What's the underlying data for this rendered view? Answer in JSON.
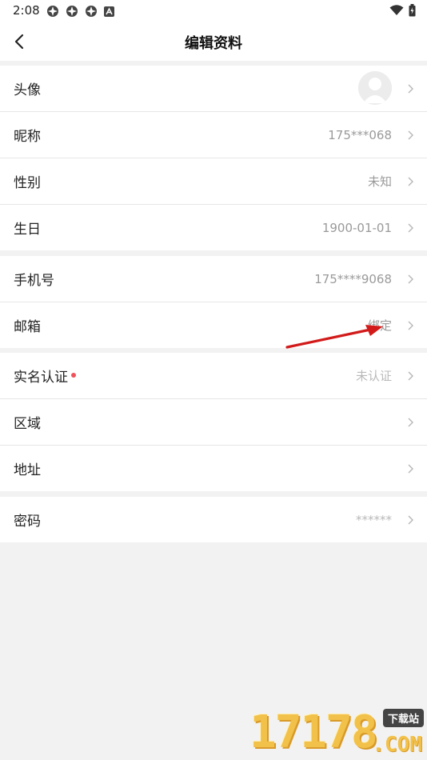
{
  "status_bar": {
    "time": "2:08"
  },
  "header": {
    "title": "编辑资料"
  },
  "groups": [
    {
      "rows": [
        {
          "label": "头像",
          "value": ""
        },
        {
          "label": "昵称",
          "value": "175***068"
        },
        {
          "label": "性别",
          "value": "未知"
        },
        {
          "label": "生日",
          "value": "1900-01-01"
        }
      ]
    },
    {
      "rows": [
        {
          "label": "手机号",
          "value": "175****9068"
        },
        {
          "label": "邮箱",
          "value": "绑定"
        }
      ]
    },
    {
      "rows": [
        {
          "label": "实名认证",
          "value": "未认证"
        },
        {
          "label": "区域",
          "value": ""
        },
        {
          "label": "地址",
          "value": ""
        }
      ]
    },
    {
      "rows": [
        {
          "label": "密码",
          "value": "******"
        }
      ]
    }
  ],
  "watermark": {
    "digits": "17178",
    "badge": "下载站",
    "suffix": ".COM"
  },
  "colors": {
    "red_dot": "#f0515a",
    "arrow": "#d21a1a",
    "background": "#f2f2f2"
  }
}
